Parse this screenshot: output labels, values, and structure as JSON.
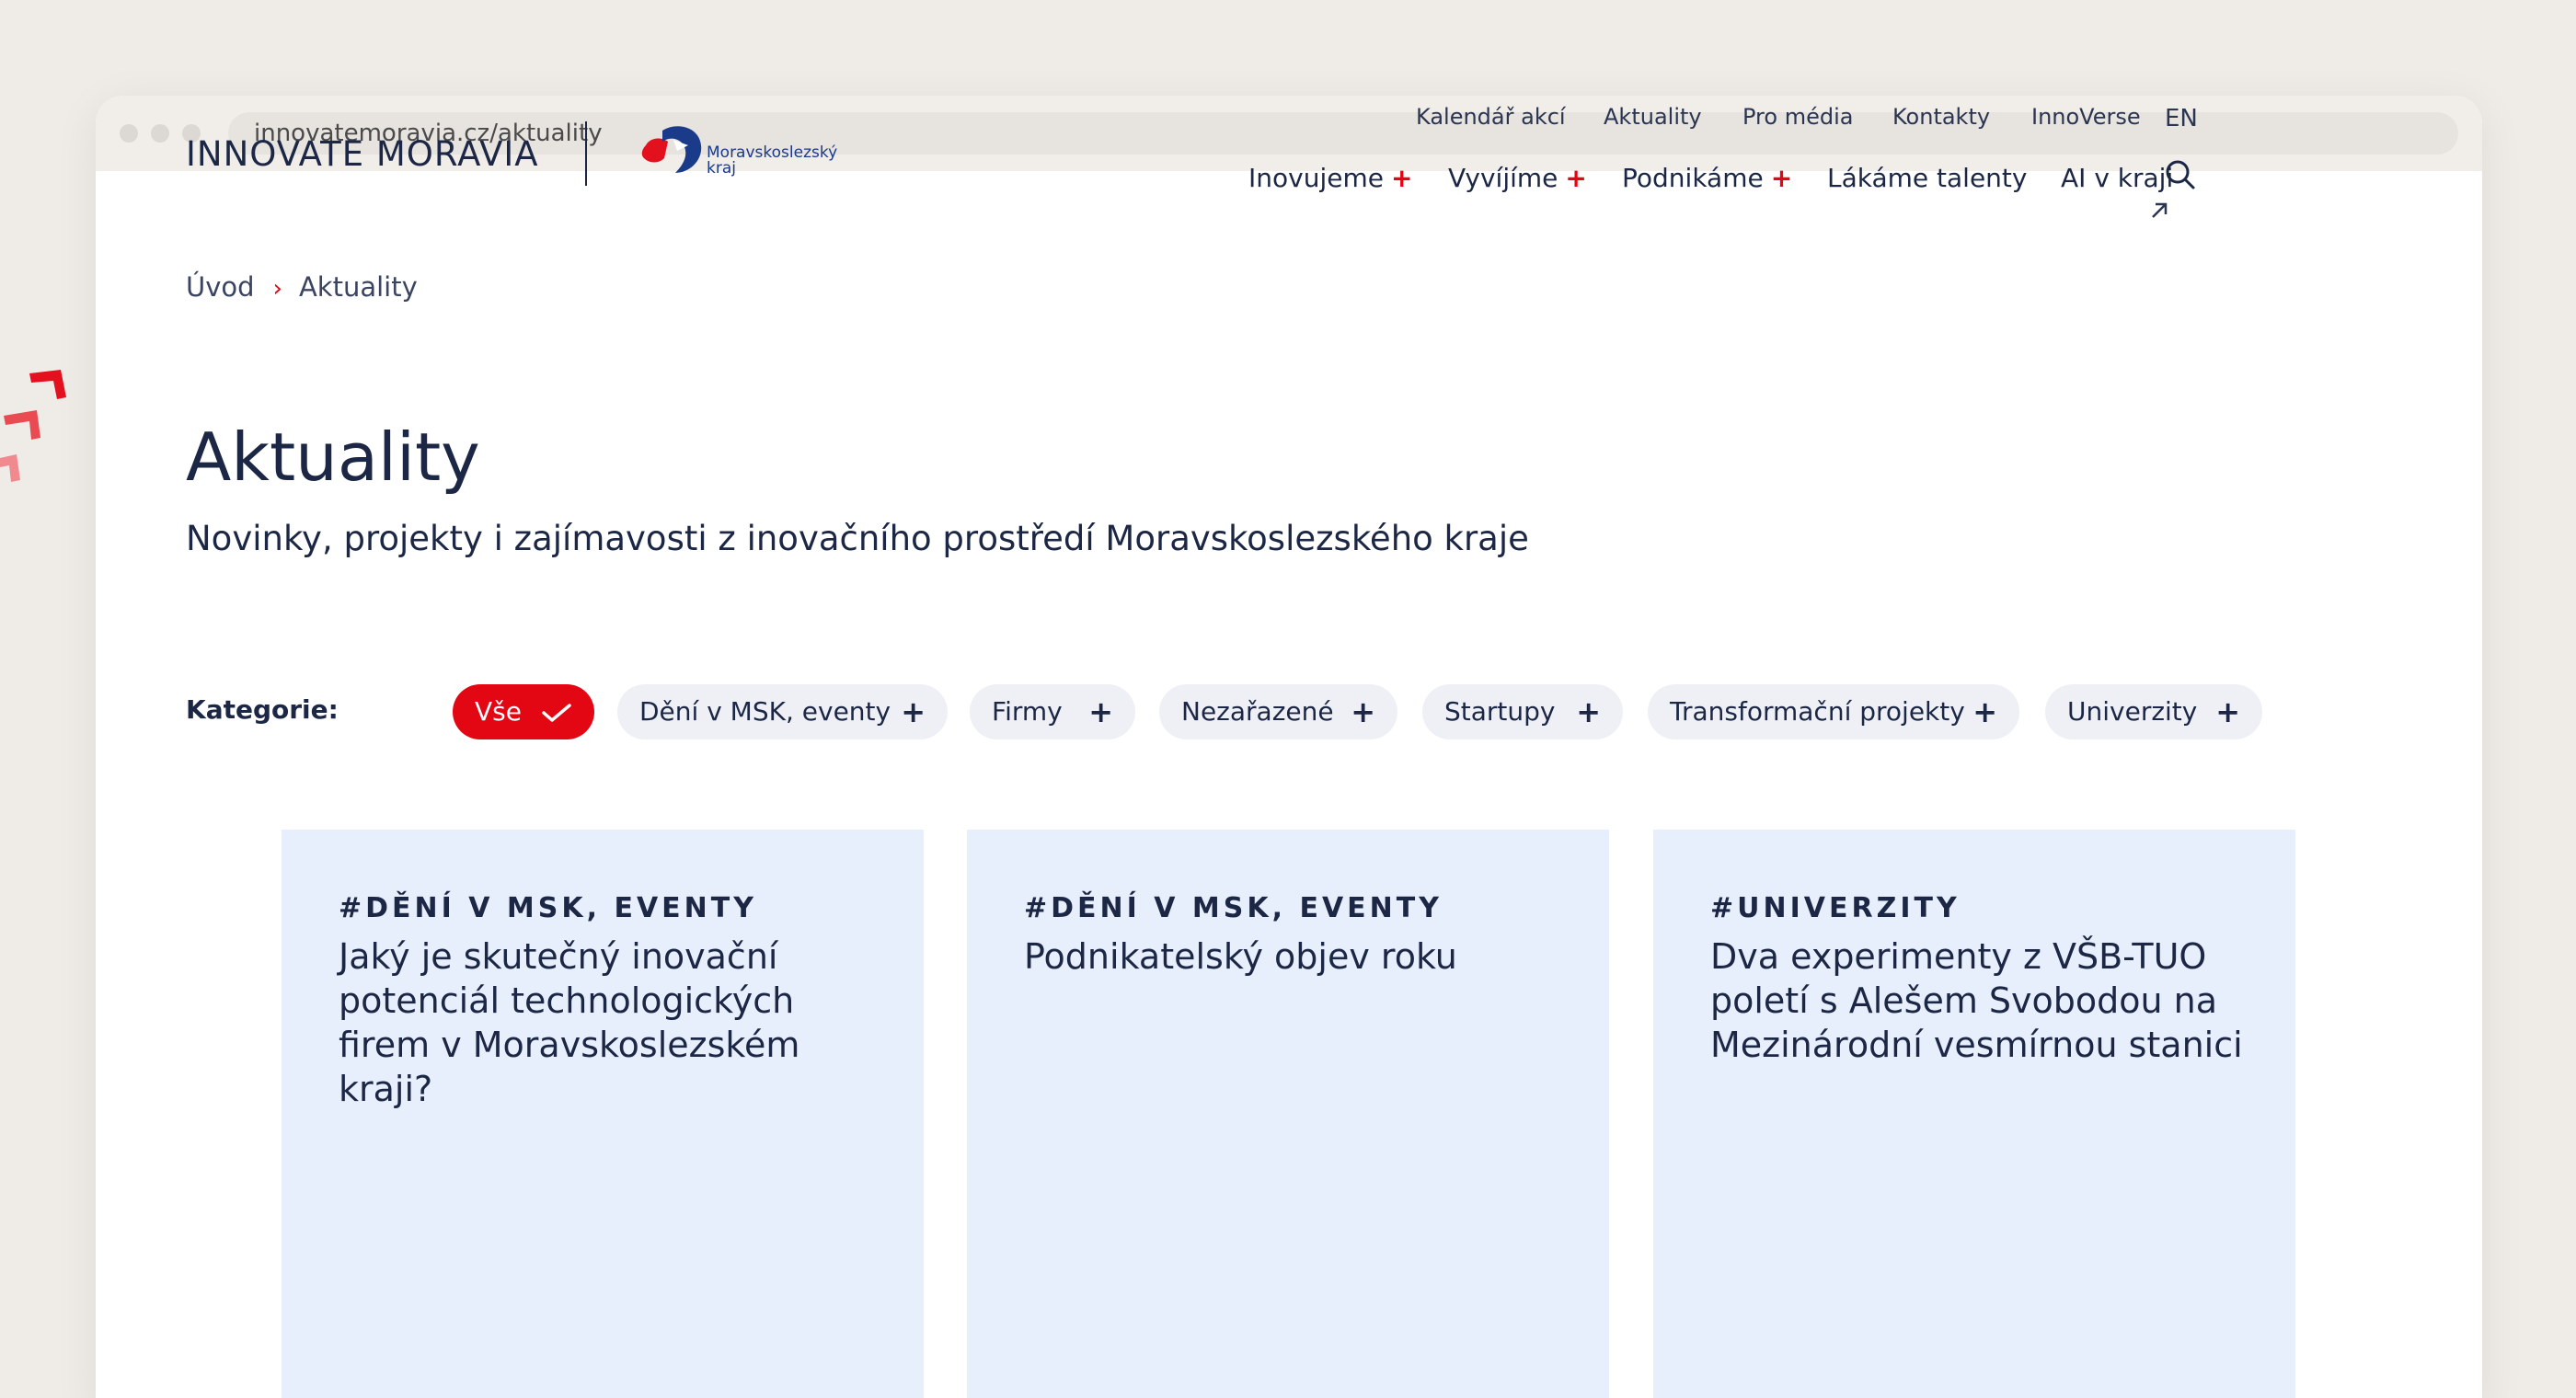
{
  "browser": {
    "url": "innovatemoravia.cz/aktuality"
  },
  "header": {
    "brand": "INNOVATE MORAVIA",
    "region_logo_text_1": "Moravskoslezský",
    "region_logo_text_2": "kraj",
    "top_links": [
      "Kalendář akcí",
      "Aktuality",
      "Pro média",
      "Kontakty",
      "InnoVerse"
    ],
    "main_links": [
      "Inovujeme",
      "Vyvíjíme",
      "Podnikáme",
      "Lákáme talenty",
      "AI v kraji"
    ],
    "plus_sign": "+",
    "language": "EN",
    "icons": {
      "external": "arrow-up-right-icon",
      "search": "search-icon"
    }
  },
  "breadcrumb": {
    "home": "Úvod",
    "separator": "›",
    "current": "Aktuality"
  },
  "page": {
    "title": "Aktuality",
    "subtitle": "Novinky, projekty i zajímavosti z inovačního prostředí Moravskoslezského kraje"
  },
  "filters": {
    "label": "Kategorie:",
    "chips": [
      {
        "label": "Vše",
        "active": true,
        "icon": "check-icon"
      },
      {
        "label": "Dění v MSK, eventy",
        "active": false,
        "icon": "plus-icon"
      },
      {
        "label": "Firmy",
        "active": false,
        "icon": "plus-icon"
      },
      {
        "label": "Nezařazené",
        "active": false,
        "icon": "plus-icon"
      },
      {
        "label": "Startupy",
        "active": false,
        "icon": "plus-icon"
      },
      {
        "label": "Transformační projekty",
        "active": false,
        "icon": "plus-icon"
      },
      {
        "label": "Univerzity",
        "active": false,
        "icon": "plus-icon"
      }
    ],
    "plus_sign": "+"
  },
  "cards": [
    {
      "tag": "#DĚNÍ V MSK, EVENTY",
      "headline": "Jaký je skutečný inovační potenciál technologických firem v Moravskoslezském kraji?"
    },
    {
      "tag": "#DĚNÍ V MSK, EVENTY",
      "headline": "Podnikatelský objev roku"
    },
    {
      "tag": "#UNIVERZITY",
      "headline": "Dva experimenty z VŠB-TUO poletí s Alešem Svobodou na Mezinárodní vesmírnou stanici"
    }
  ],
  "colors": {
    "accent": "#e30613",
    "navy": "#1c2745",
    "card_bg": "#e8effc",
    "chip_bg": "#eef0f5",
    "page_bg": "#efebe6"
  }
}
